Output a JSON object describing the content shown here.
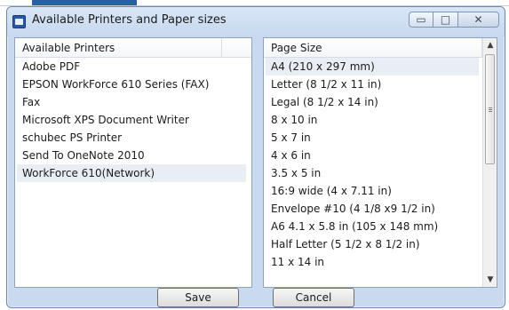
{
  "window": {
    "title": "Available Printers and Paper sizes",
    "controls": {
      "minimize_glyph": "▭",
      "maximize_glyph": "□",
      "close_glyph": "✕"
    }
  },
  "printers": {
    "header": "Available Printers",
    "items": [
      "Adobe PDF",
      "EPSON WorkForce 610 Series (FAX)",
      "Fax",
      "Microsoft XPS Document Writer",
      "schubec PS Printer",
      "Send To OneNote 2010",
      "WorkForce 610(Network)"
    ],
    "selected_index": 6
  },
  "paper_sizes": {
    "header": "Page Size",
    "items": [
      "A4 (210 x 297 mm)",
      "Letter (8 1/2 x 11 in)",
      "Legal (8 1/2 x 14 in)",
      "8 x 10 in",
      "5 x 7 in",
      "4 x 6 in",
      "3.5 x 5 in",
      "16:9 wide (4 x 7.11 in)",
      "Envelope #10 (4 1/8 x9 1/2 in)",
      "A6 4.1 x 5.8 in (105 x 148 mm)",
      "Half Letter (5 1/2 x 8 1/2 in)",
      "11 x 14 in"
    ],
    "selected_index": 0,
    "scroll": {
      "up_glyph": "▲",
      "down_glyph": "▼"
    }
  },
  "buttons": {
    "save_label": "Save",
    "cancel_label": "Cancel"
  },
  "colors": {
    "window_frame": "#c9d9ee",
    "selection": "#e9eef4",
    "app_icon": "#2b57a7"
  }
}
